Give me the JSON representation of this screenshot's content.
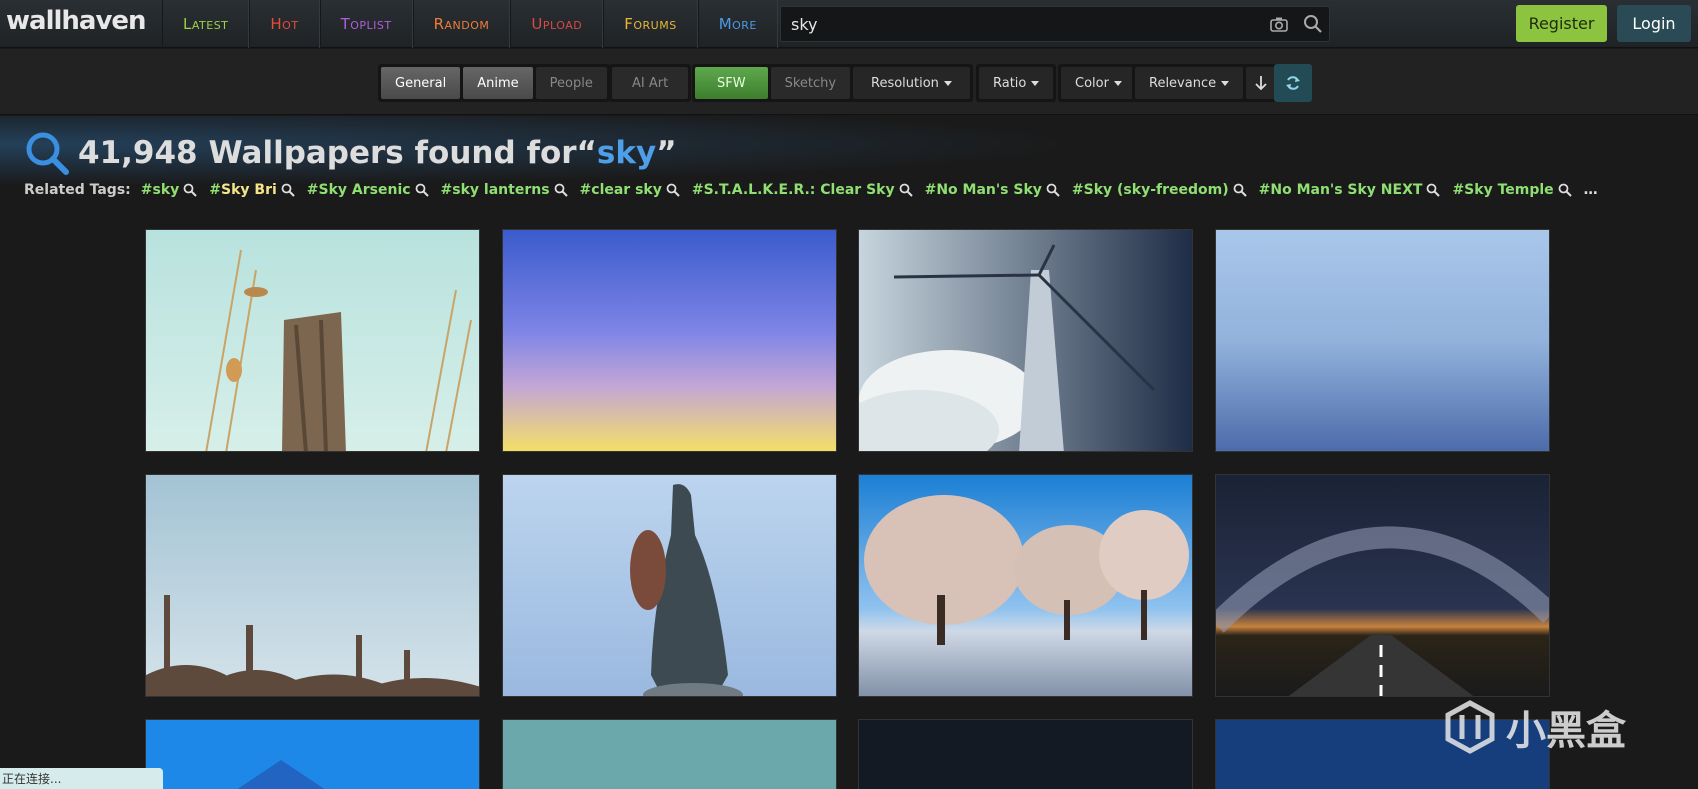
{
  "logo": "wallhaven",
  "nav": [
    {
      "label": "Latest",
      "color": "#9dd046"
    },
    {
      "label": "Hot",
      "color": "#e84a3c"
    },
    {
      "label": "Toplist",
      "color": "#b15ed8"
    },
    {
      "label": "Random",
      "color": "#ef7d3a"
    },
    {
      "label": "Upload",
      "color": "#d64a45"
    },
    {
      "label": "Forums",
      "color": "#e8b838"
    },
    {
      "label": "More",
      "color": "#4a9ae6"
    }
  ],
  "search": {
    "value": "sky"
  },
  "auth": {
    "register": "Register",
    "login": "Login"
  },
  "filters": {
    "categories": [
      {
        "label": "General",
        "on": true
      },
      {
        "label": "Anime",
        "on": true
      },
      {
        "label": "People",
        "on": false
      }
    ],
    "ai": {
      "label": "AI Art"
    },
    "purity": [
      {
        "label": "SFW",
        "on": true
      },
      {
        "label": "Sketchy",
        "on": false
      }
    ],
    "dropdowns": [
      "Resolution",
      "Ratio",
      "Color",
      "Relevance"
    ]
  },
  "results": {
    "count": "41,948",
    "text": "Wallpapers found for",
    "open_quote": "“",
    "query": "sky",
    "close_quote": "”"
  },
  "related": {
    "label": "Related Tags:",
    "tags": [
      {
        "name": "sky",
        "sketchy": false
      },
      {
        "name": "Sky Bri",
        "sketchy": true
      },
      {
        "name": "Sky Arsenic",
        "sketchy": false
      },
      {
        "name": "sky lanterns",
        "sketchy": false
      },
      {
        "name": "clear sky",
        "sketchy": false
      },
      {
        "name": "S.T.A.L.K.E.R.: Clear Sky",
        "sketchy": false
      },
      {
        "name": "No Man's Sky",
        "sketchy": false
      },
      {
        "name": "Sky (sky-freedom)",
        "sketchy": false
      },
      {
        "name": "No Man's Sky NEXT",
        "sketchy": false
      },
      {
        "name": "Sky Temple",
        "sketchy": false
      }
    ],
    "more": "…"
  },
  "status": "正在连接...",
  "watermark": "小黑盒"
}
